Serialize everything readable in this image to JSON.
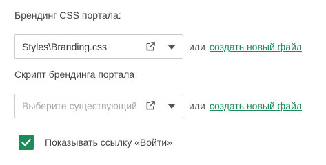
{
  "branding_css": {
    "label": "Брендинг CSS портала:",
    "value": "Styles\\Branding.css",
    "or_text": "или",
    "create_link": "создать новый файл"
  },
  "branding_script": {
    "label": "Скрипт брендинга портала",
    "placeholder": "Выберите существующий",
    "or_text": "или",
    "create_link": "создать новый файл"
  },
  "show_login_link": {
    "label": "Показывать ссылку «Войти»",
    "checked": true
  },
  "colors": {
    "accent": "#1e8c5a",
    "border": "#cccccc",
    "placeholder": "#a8a8a8",
    "text": "#444444"
  },
  "icons": {
    "open": "open-in-new-icon",
    "dropdown": "chevron-down-icon",
    "check": "checkmark-icon"
  }
}
